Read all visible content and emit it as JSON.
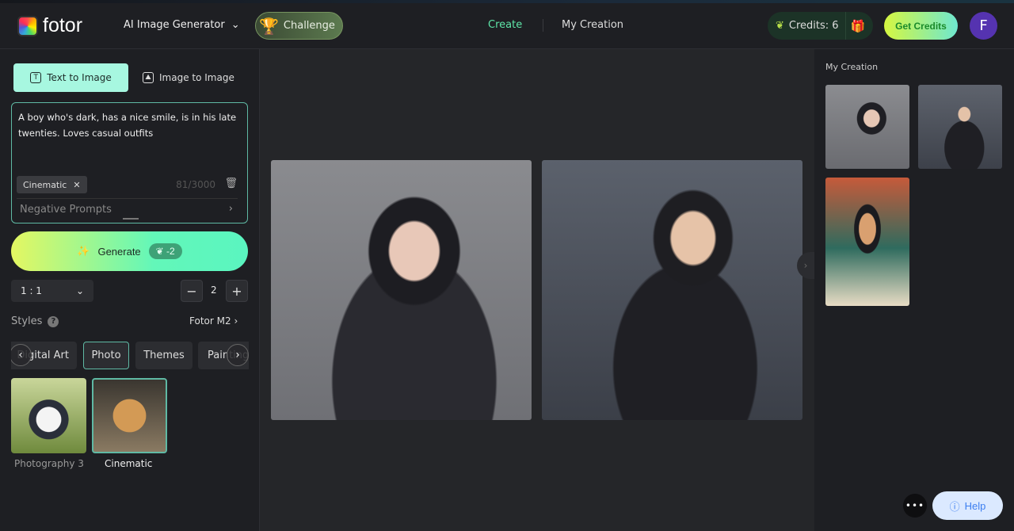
{
  "header": {
    "logo_text": "fotor",
    "product_menu": "AI Image Generator",
    "challenge_label": "Challenge",
    "tabs": [
      {
        "label": "Create",
        "active": true
      },
      {
        "label": "My Creation",
        "active": false
      }
    ],
    "credits_label": "Credits: 6",
    "get_credits_label": "Get Credits",
    "avatar_initial": "F",
    "accent_color": "#5ee6a8"
  },
  "left": {
    "mode_tabs": [
      {
        "label": "Text to Image",
        "active": true
      },
      {
        "label": "Image to Image",
        "active": false
      }
    ],
    "prompt": "A boy who's dark, has a nice smile, is in his late twenties. Loves casual outfits",
    "style_chip": "Cinematic",
    "char_count": "81/3000",
    "negative_prompts_label": "Negative Prompts",
    "generate_label": "Generate",
    "generate_cost": "-2",
    "aspect_ratio": "1 : 1",
    "image_count": "2",
    "styles_label": "Styles",
    "model_label": "Fotor M2",
    "categories": [
      "Digital Art",
      "Photo",
      "Themes",
      "Painting"
    ],
    "active_category": "Photo",
    "style_presets": [
      {
        "label": "Photography 3",
        "selected": false
      },
      {
        "label": "Cinematic",
        "selected": true
      }
    ]
  },
  "right": {
    "title": "My Creation"
  },
  "footer": {
    "more_label": "•••",
    "help_label": "Help"
  }
}
